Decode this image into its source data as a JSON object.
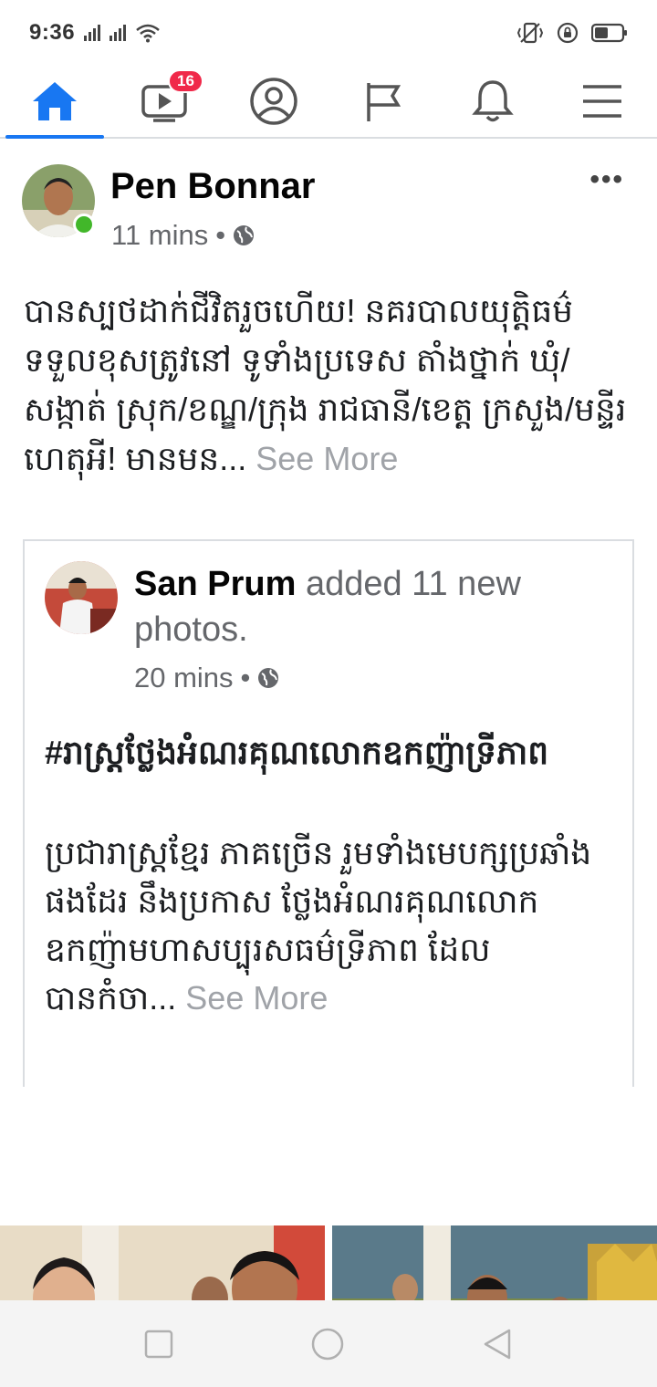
{
  "status": {
    "time": "9:36"
  },
  "nav": {
    "video_badge": "16"
  },
  "post": {
    "author": "Pen Bonnar",
    "time": "11 mins",
    "separator": "•",
    "text": "បានស្បថដាក់ជីវិតរួចហើយ! នគរបាលយុត្តិធម៌ ទទួលខុសត្រូវនៅ ទូទាំងប្រទេស តាំងថ្នាក់ ឃុំ/សង្កាត់ ស្រុក/ខណ្ឌ/ក្រុង រាជធានី/ខេត្ត ក្រសួង/មន្ទីរ ហេតុអី! មានមន...",
    "see_more": "See More"
  },
  "shared": {
    "author": "San Prum",
    "action": "added 11 new photos.",
    "time": "20 mins",
    "separator": "•",
    "title": "#រាស្ត្រថ្លែងអំណរគុណលោកឧកញ៉ាទ្រីភាព",
    "body": "ប្រជារាស្ត្រខ្មែរ ភាគច្រើន រួមទាំងមេបក្សប្រឆាំងផងដែរ  នឹងប្រកាស ថ្លែងអំណរគុណលោកឧកញ៉ាមហាសប្បុរសធម៌ទ្រីភាព ដែលបានកំចា...",
    "see_more": "See More"
  },
  "colors": {
    "accent": "#1877f2",
    "badge": "#f02849",
    "online": "#42b72a",
    "muted": "#65676b"
  }
}
